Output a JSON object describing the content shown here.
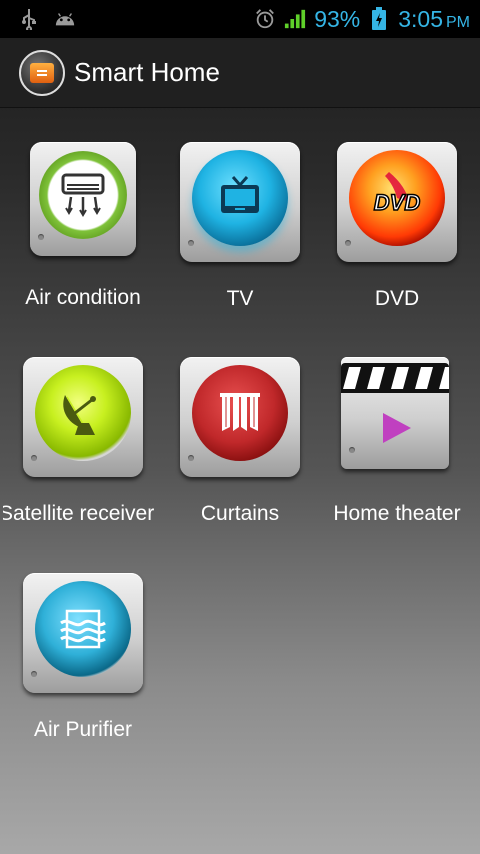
{
  "status_bar": {
    "battery_percent": "93%",
    "time": "3:05",
    "ampm": "PM",
    "icons": [
      "usb-icon",
      "android-icon",
      "alarm-icon",
      "signal-icon",
      "battery-icon"
    ]
  },
  "action_bar": {
    "title": "Smart Home",
    "logo_icon": "menu-icon"
  },
  "devices": [
    {
      "label": "Air condition",
      "icon": "air-conditioner-icon",
      "color": "#7fc23a"
    },
    {
      "label": "TV",
      "icon": "tv-icon",
      "color": "#1fb3e3"
    },
    {
      "label": "DVD",
      "icon": "dvd-icon",
      "color": "#ff5a10"
    },
    {
      "label": "Satellite receiver",
      "icon": "satellite-dish-icon",
      "color": "#a8d810"
    },
    {
      "label": "Curtains",
      "icon": "curtains-icon",
      "color": "#c0282a"
    },
    {
      "label": "Home theater",
      "icon": "clapperboard-icon",
      "color": "#c040c0"
    },
    {
      "label": "Air Purifier",
      "icon": "air-purifier-icon",
      "color": "#2fb0d8"
    }
  ]
}
